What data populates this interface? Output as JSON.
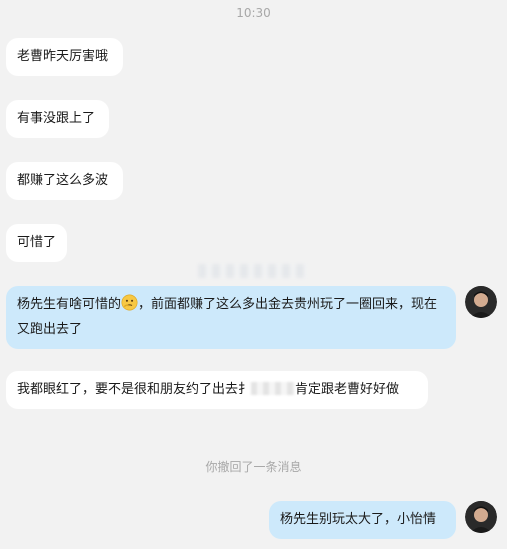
{
  "timestamp": "10:30",
  "messages": [
    {
      "side": "left",
      "text": "老曹昨天厉害哦"
    },
    {
      "side": "left",
      "text": "有事没跟上了"
    },
    {
      "side": "left",
      "text": "都赚了这么多波"
    },
    {
      "side": "left",
      "text": "可惜了"
    },
    {
      "side": "right",
      "text_a": "杨先生有啥可惜的",
      "emoji": "thinking-face",
      "text_b": "，前面都赚了这么多出金去贵州玩了一圈回来，现在又跑出去了"
    },
    {
      "side": "left",
      "text_a": "我都眼红了，要不是很和朋友约了出去扌",
      "text_b": "肯定跟老曹好好做"
    },
    {
      "side": "right",
      "text": "杨先生别玩太大了，小怡情"
    }
  ],
  "system_notice": "你撤回了一条消息",
  "colors": {
    "background": "#f2f2f2",
    "left_bubble": "#ffffff",
    "right_bubble": "#cde9fb"
  }
}
